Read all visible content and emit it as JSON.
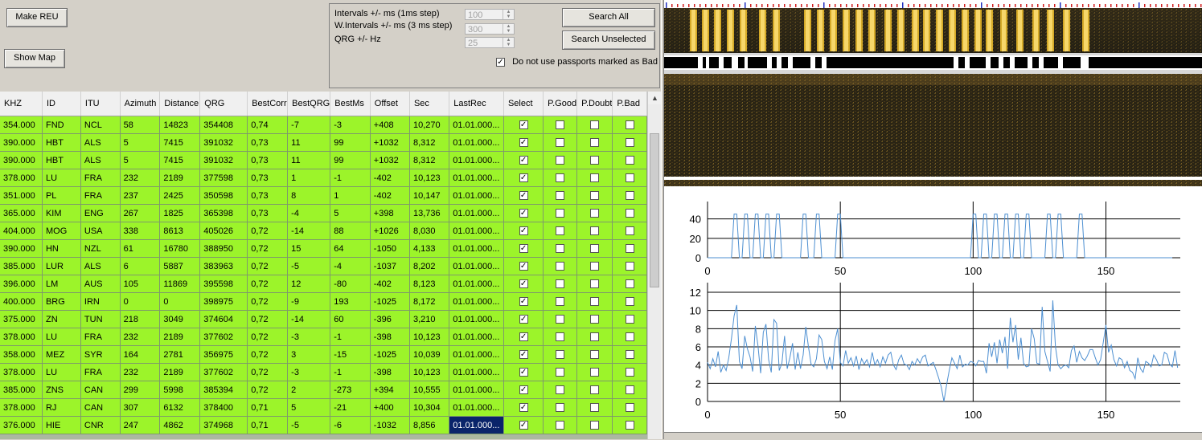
{
  "buttons": {
    "make_reu": "Make REU",
    "show_map": "Show Map",
    "search_all": "Search All",
    "search_unselected": "Search Unselected"
  },
  "params": {
    "intervals_label": "Intervals +/- ms (1ms step)",
    "intervals_value": "100",
    "w_intervals_label": "W.Intervals +/- ms (3 ms step)",
    "w_intervals_value": "300",
    "qrg_label": "QRG +/- Hz",
    "qrg_value": "25",
    "no_bad_label": "Do not use passports marked as Bad",
    "no_bad_checked": true
  },
  "table": {
    "columns": [
      "KHZ",
      "ID",
      "ITU",
      "Azimuth",
      "Distance",
      "QRG",
      "BestCorr",
      "BestQRG",
      "BestMs",
      "Offset",
      "Sec",
      "LastRec",
      "Select",
      "P.Good",
      "P.Doubt",
      "P.Bad"
    ],
    "rows": [
      {
        "khz": "354.000",
        "id": "FND",
        "itu": "NCL",
        "az": "58",
        "dist": "14823",
        "qrg": "354408",
        "corr": "0,74",
        "bqrg": "-7",
        "bms": "-3",
        "off": "+408",
        "sec": "10,270",
        "last": "01.01.000..."
      },
      {
        "khz": "390.000",
        "id": "HBT",
        "itu": "ALS",
        "az": "5",
        "dist": "7415",
        "qrg": "391032",
        "corr": "0,73",
        "bqrg": "11",
        "bms": "99",
        "off": "+1032",
        "sec": "8,312",
        "last": "01.01.000..."
      },
      {
        "khz": "390.000",
        "id": "HBT",
        "itu": "ALS",
        "az": "5",
        "dist": "7415",
        "qrg": "391032",
        "corr": "0,73",
        "bqrg": "11",
        "bms": "99",
        "off": "+1032",
        "sec": "8,312",
        "last": "01.01.000..."
      },
      {
        "khz": "378.000",
        "id": "LU",
        "itu": "FRA",
        "az": "232",
        "dist": "2189",
        "qrg": "377598",
        "corr": "0,73",
        "bqrg": "1",
        "bms": "-1",
        "off": "-402",
        "sec": "10,123",
        "last": "01.01.000..."
      },
      {
        "khz": "351.000",
        "id": "PL",
        "itu": "FRA",
        "az": "237",
        "dist": "2425",
        "qrg": "350598",
        "corr": "0,73",
        "bqrg": "8",
        "bms": "1",
        "off": "-402",
        "sec": "10,147",
        "last": "01.01.000..."
      },
      {
        "khz": "365.000",
        "id": "KIM",
        "itu": "ENG",
        "az": "267",
        "dist": "1825",
        "qrg": "365398",
        "corr": "0,73",
        "bqrg": "-4",
        "bms": "5",
        "off": "+398",
        "sec": "13,736",
        "last": "01.01.000..."
      },
      {
        "khz": "404.000",
        "id": "MOG",
        "itu": "USA",
        "az": "338",
        "dist": "8613",
        "qrg": "405026",
        "corr": "0,72",
        "bqrg": "-14",
        "bms": "88",
        "off": "+1026",
        "sec": "8,030",
        "last": "01.01.000..."
      },
      {
        "khz": "390.000",
        "id": "HN",
        "itu": "NZL",
        "az": "61",
        "dist": "16780",
        "qrg": "388950",
        "corr": "0,72",
        "bqrg": "15",
        "bms": "64",
        "off": "-1050",
        "sec": "4,133",
        "last": "01.01.000..."
      },
      {
        "khz": "385.000",
        "id": "LUR",
        "itu": "ALS",
        "az": "6",
        "dist": "5887",
        "qrg": "383963",
        "corr": "0,72",
        "bqrg": "-5",
        "bms": "-4",
        "off": "-1037",
        "sec": "8,202",
        "last": "01.01.000..."
      },
      {
        "khz": "396.000",
        "id": "LM",
        "itu": "AUS",
        "az": "105",
        "dist": "11869",
        "qrg": "395598",
        "corr": "0,72",
        "bqrg": "12",
        "bms": "-80",
        "off": "-402",
        "sec": "8,123",
        "last": "01.01.000..."
      },
      {
        "khz": "400.000",
        "id": "BRG",
        "itu": "IRN",
        "az": "0",
        "dist": "0",
        "qrg": "398975",
        "corr": "0,72",
        "bqrg": "-9",
        "bms": "193",
        "off": "-1025",
        "sec": "8,172",
        "last": "01.01.000..."
      },
      {
        "khz": "375.000",
        "id": "ZN",
        "itu": "TUN",
        "az": "218",
        "dist": "3049",
        "qrg": "374604",
        "corr": "0,72",
        "bqrg": "-14",
        "bms": "60",
        "off": "-396",
        "sec": "3,210",
        "last": "01.01.000..."
      },
      {
        "khz": "378.000",
        "id": "LU",
        "itu": "FRA",
        "az": "232",
        "dist": "2189",
        "qrg": "377602",
        "corr": "0,72",
        "bqrg": "-3",
        "bms": "-1",
        "off": "-398",
        "sec": "10,123",
        "last": "01.01.000..."
      },
      {
        "khz": "358.000",
        "id": "MEZ",
        "itu": "SYR",
        "az": "164",
        "dist": "2781",
        "qrg": "356975",
        "corr": "0,72",
        "bqrg": "3",
        "bms": "-15",
        "off": "-1025",
        "sec": "10,039",
        "last": "01.01.000..."
      },
      {
        "khz": "378.000",
        "id": "LU",
        "itu": "FRA",
        "az": "232",
        "dist": "2189",
        "qrg": "377602",
        "corr": "0,72",
        "bqrg": "-3",
        "bms": "-1",
        "off": "-398",
        "sec": "10,123",
        "last": "01.01.000..."
      },
      {
        "khz": "385.000",
        "id": "ZNS",
        "itu": "CAN",
        "az": "299",
        "dist": "5998",
        "qrg": "385394",
        "corr": "0,72",
        "bqrg": "2",
        "bms": "-273",
        "off": "+394",
        "sec": "10,555",
        "last": "01.01.000..."
      },
      {
        "khz": "378.000",
        "id": "RJ",
        "itu": "CAN",
        "az": "307",
        "dist": "6132",
        "qrg": "378400",
        "corr": "0,71",
        "bqrg": "5",
        "bms": "-21",
        "off": "+400",
        "sec": "10,304",
        "last": "01.01.000..."
      },
      {
        "khz": "376.000",
        "id": "HIE",
        "itu": "CNR",
        "az": "247",
        "dist": "4862",
        "qrg": "374968",
        "corr": "0,71",
        "bqrg": "-5",
        "bms": "-6",
        "off": "-1032",
        "sec": "8,856",
        "last": "01.01.000..."
      }
    ],
    "selected_row": 17
  },
  "colors": {
    "row_bg": "#9cf42a",
    "selection": "#0a246a",
    "spectrogram_signal": "#f2c12c",
    "plot_line": "#4d8fd1"
  },
  "chart_data": [
    {
      "type": "line",
      "ylim": [
        0,
        48
      ],
      "xlim": [
        0,
        178
      ],
      "xticks": [
        0,
        50,
        100,
        150
      ],
      "yticks": [
        0,
        20,
        40
      ],
      "series": [
        {
          "values": [
            0,
            0,
            0,
            0,
            0,
            0,
            0,
            0,
            0,
            0,
            45,
            45,
            0,
            0,
            45,
            45,
            0,
            0,
            45,
            45,
            0,
            0,
            45,
            45,
            0,
            0,
            45,
            45,
            0,
            0,
            0,
            0,
            0,
            0,
            0,
            0,
            45,
            45,
            0,
            0,
            0,
            45,
            45,
            0,
            0,
            0,
            0,
            0,
            0,
            45,
            45,
            0,
            0,
            0,
            0,
            0,
            0,
            0,
            0,
            0,
            0,
            0,
            0,
            0,
            0,
            0,
            0,
            0,
            0,
            0,
            0,
            0,
            0,
            0,
            0,
            0,
            0,
            0,
            0,
            0,
            0,
            0,
            0,
            0,
            0,
            0,
            0,
            0,
            0,
            0,
            0,
            0,
            0,
            0,
            0,
            0,
            0,
            0,
            0,
            0,
            45,
            45,
            0,
            0,
            45,
            45,
            0,
            0,
            45,
            45,
            0,
            0,
            45,
            45,
            0,
            0,
            45,
            45,
            0,
            0,
            45,
            45,
            0,
            0,
            0,
            0,
            0,
            0,
            45,
            45,
            0,
            0,
            45,
            45,
            0,
            0,
            0,
            0,
            0,
            0,
            45,
            45,
            0,
            0,
            0,
            0,
            0,
            0,
            0,
            0,
            0,
            0,
            0,
            0,
            0,
            0,
            0,
            0,
            0,
            0,
            0,
            0,
            0,
            0,
            0,
            0,
            0,
            0,
            0,
            0,
            0,
            0,
            0,
            0,
            0,
            0
          ]
        }
      ]
    },
    {
      "type": "line",
      "ylim": [
        0,
        12
      ],
      "xlim": [
        0,
        178
      ],
      "xticks": [
        0,
        50,
        100,
        150
      ],
      "yticks": [
        0,
        2,
        4,
        6,
        8,
        10,
        12
      ],
      "series": [
        {
          "values": [
            4.3,
            3.6,
            4.7,
            3.8,
            5.5,
            3.2,
            4.0,
            3.4,
            4.8,
            6.9,
            9.4,
            10.6,
            4.4,
            3.6,
            7.2,
            5.8,
            4.9,
            3.3,
            8.3,
            6.1,
            3.1,
            7.6,
            8.5,
            4.6,
            3.2,
            9.0,
            8.6,
            3.4,
            4.2,
            7.2,
            3.6,
            4.8,
            6.4,
            3.5,
            5.4,
            3.6,
            5.1,
            8.2,
            6.0,
            4.1,
            3.8,
            4.7,
            7.3,
            6.8,
            4.4,
            3.6,
            4.9,
            3.5,
            6.7,
            8.0,
            4.3,
            3.9,
            5.6,
            4.2,
            4.8,
            3.9,
            5.0,
            3.5,
            4.7,
            4.1,
            4.6,
            3.8,
            5.4,
            4.0,
            4.6,
            3.8,
            4.9,
            4.2,
            5.1,
            5.4,
            4.0,
            3.5,
            4.6,
            5.1,
            4.1,
            4.0,
            3.5,
            4.4,
            4.0,
            4.7,
            4.2,
            4.9,
            5.1,
            3.9,
            4.1,
            4.3,
            3.5,
            2.6,
            1.6,
            0.0,
            1.8,
            3.4,
            4.8,
            4.2,
            3.6,
            5.1,
            3.8,
            4.1,
            4.0,
            4.4,
            4.3,
            3.9,
            4.5,
            4.4,
            4.4,
            3.1,
            6.4,
            4.9,
            6.5,
            4.2,
            6.8,
            5.3,
            7.1,
            3.6,
            9.2,
            6.5,
            8.4,
            4.6,
            7.0,
            4.2,
            3.8,
            3.9,
            8.0,
            6.9,
            4.2,
            4.1,
            10.4,
            5.5,
            4.4,
            3.3,
            11.1,
            6.0,
            4.0,
            3.6,
            3.9,
            4.0,
            3.7,
            5.6,
            6.1,
            4.3,
            5.5,
            4.8,
            4.5,
            5.0,
            5.7,
            5.7,
            4.8,
            4.0,
            4.6,
            6.5,
            8.4,
            5.4,
            6.2,
            4.6,
            3.9,
            4.8,
            4.6,
            3.7,
            4.4,
            3.4,
            3.2,
            2.5,
            4.8,
            3.6,
            3.2,
            4.4,
            4.2,
            3.8,
            5.1,
            4.6,
            3.9,
            4.0,
            5.4,
            5.2,
            4.1,
            3.8,
            5.6,
            3.7
          ]
        }
      ]
    }
  ]
}
